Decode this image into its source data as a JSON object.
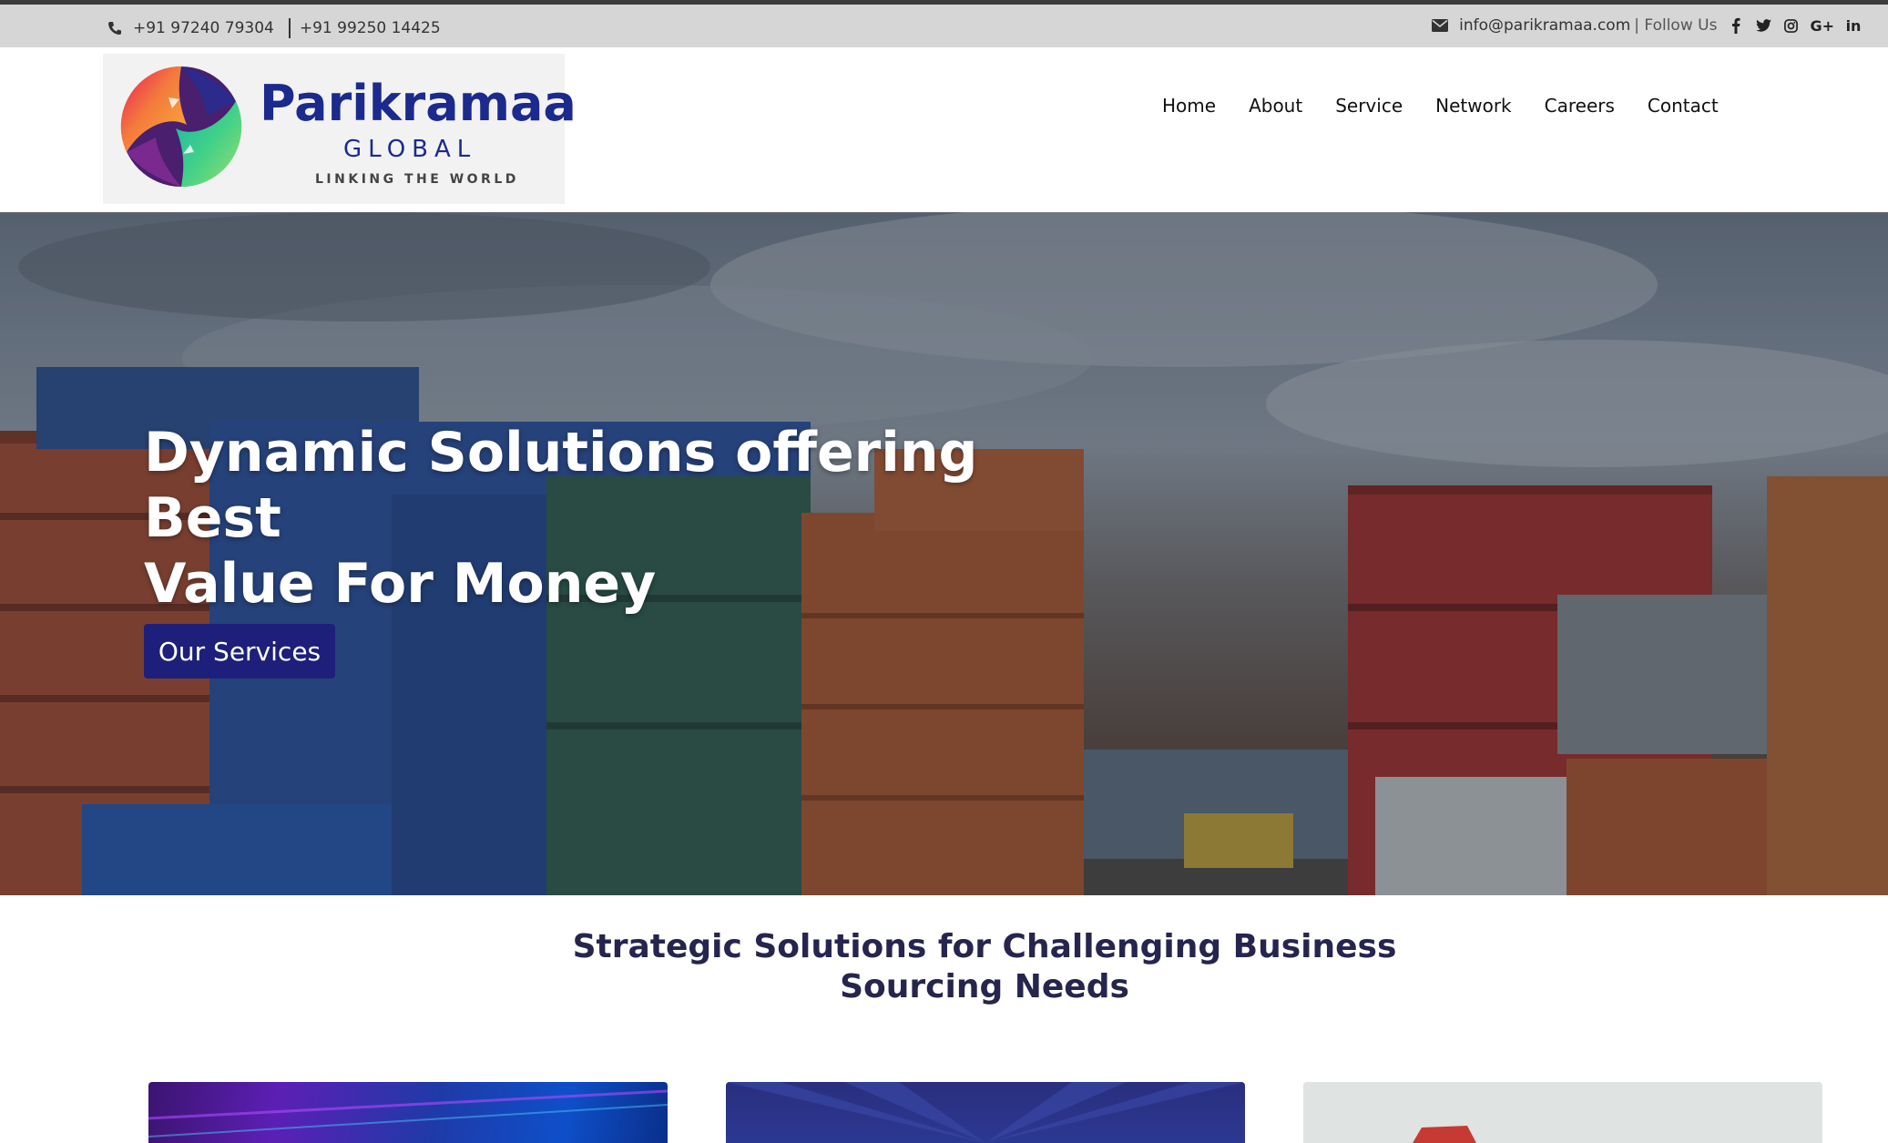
{
  "topbar": {
    "phone1": "+91 97240 79304",
    "phone2": "+91 99250 14425",
    "email": "info@parikramaa.com",
    "follow_label": "| Follow Us",
    "social": [
      {
        "name": "facebook-icon",
        "glyph": "f"
      },
      {
        "name": "twitter-icon",
        "glyph": "t"
      },
      {
        "name": "instagram-icon",
        "glyph": ""
      },
      {
        "name": "google-plus-icon",
        "glyph": "G+"
      },
      {
        "name": "linkedin-icon",
        "glyph": "in"
      }
    ]
  },
  "logo": {
    "name": "Parikramaa",
    "subtitle": "GLOBAL",
    "tagline": "LINKING THE WORLD"
  },
  "nav": {
    "items": [
      "Home",
      "About",
      "Service",
      "Network",
      "Careers",
      "Contact"
    ]
  },
  "hero": {
    "title_line1": "Dynamic Solutions offering Best",
    "title_line2": "Value For Money",
    "button_label": "Our Services"
  },
  "section": {
    "title_line1": "Strategic Solutions for Challenging Business",
    "title_line2": "Sourcing Needs"
  },
  "colors": {
    "brand_blue": "#1b2a8c",
    "button_bg": "#1e1f7a",
    "topbar_bg": "#d6d6d6",
    "heading_color": "#26254e"
  }
}
